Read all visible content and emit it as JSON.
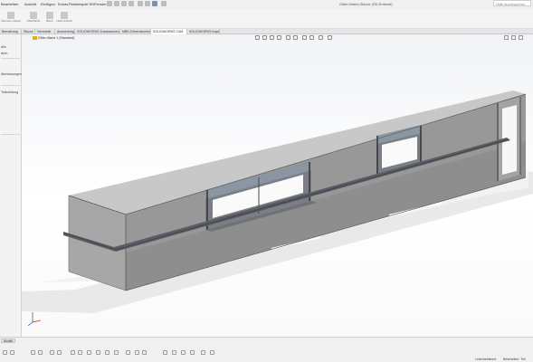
{
  "menubar": {
    "items": [
      "Bearbeiten",
      "Ansicht",
      "Einfügen",
      "Extras",
      "Planbeispiel SD",
      "Fenster"
    ],
    "title": "Gitter-Wand-Skizze (SD-Entwurf)",
    "search_placeholder": "Hilfe durchsuchen"
  },
  "toolbar": {
    "buttons": [
      {
        "label": "Volumen- körper"
      },
      {
        "label": "Oberfläche"
      },
      {
        "label": "Blech"
      },
      {
        "label": "Linke Ansicht"
      }
    ]
  },
  "tabs": [
    "Bemaßung",
    "Skizze",
    "Normteile",
    "Auswertung",
    "SOLIDWORKS Zusatzanwendungen",
    "MBD-Dimensionierung",
    "SOLIDWORKS CAM",
    "SOLIDWORKS Inspection"
  ],
  "active_tab": 6,
  "left_panel": {
    "line1": "Alle",
    "line2": "Anm.",
    "line3": "Abmessungen",
    "line4": "Teilmeldung"
  },
  "viewport": {
    "tree_label": "Gitter-Wand 1 (Standard)",
    "model_color": "#9a9a9a",
    "accent_color": "#0078d4"
  },
  "statusbar": {
    "sheet_tab": "Modell",
    "left_text": "",
    "right_text1": "Unterbestimmt",
    "right_text2": "Bearbeiten: Teil"
  }
}
